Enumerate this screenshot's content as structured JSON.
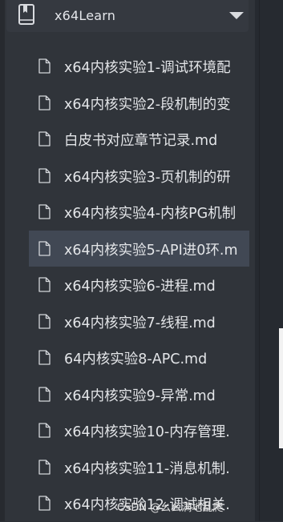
{
  "sidebar": {
    "header": {
      "title": "x64Learn",
      "icon": "book-icon",
      "dropdown_icon": "caret-down-icon"
    },
    "files": [
      {
        "label": "x64内核实验1-调试环境配",
        "active": false
      },
      {
        "label": "x64内核实验2-段机制的变",
        "active": false
      },
      {
        "label": "白皮书对应章节记录.md",
        "active": false
      },
      {
        "label": "x64内核实验3-页机制的研",
        "active": false
      },
      {
        "label": "x64内核实验4-内核PG机制",
        "active": false
      },
      {
        "label": "x64内核实验5-API进0环.m",
        "active": true
      },
      {
        "label": "x64内核实验6-进程.md",
        "active": false
      },
      {
        "label": "x64内核实验7-线程.md",
        "active": false
      },
      {
        "label": "64内核实验8-APC.md",
        "active": false
      },
      {
        "label": "x64内核实验9-异常.md",
        "active": false
      },
      {
        "label": "x64内核实验10-内存管理.",
        "active": false
      },
      {
        "label": "x64内核实验11-消息机制.",
        "active": false
      },
      {
        "label": "x64内核实验12-调试相关.",
        "active": false
      }
    ]
  },
  "watermark": "CSDN @幺幺满地乱爬",
  "colors": {
    "sidebar_bg": "#30343a",
    "active_item_bg": "#414854",
    "text": "#e3e5e8"
  }
}
